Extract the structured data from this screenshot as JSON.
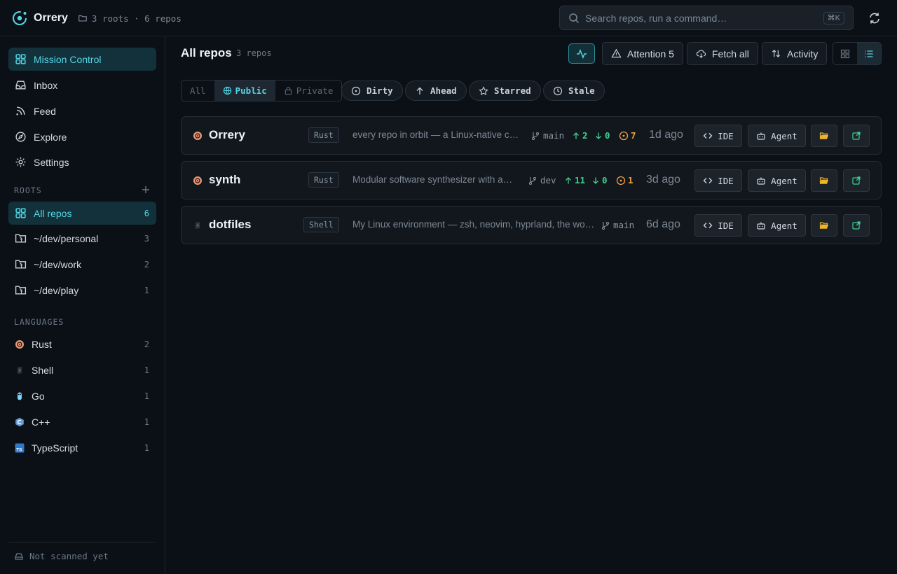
{
  "app": {
    "name": "Orrery",
    "meta": "3 roots · 6 repos",
    "accent": "#55d6e6"
  },
  "search": {
    "placeholder": "Search repos, run a command…",
    "shortcut": "⌘K"
  },
  "sidebar": {
    "nav": [
      {
        "label": "Mission Control",
        "icon": "grid-icon",
        "active": true
      },
      {
        "label": "Inbox",
        "icon": "inbox-icon"
      },
      {
        "label": "Feed",
        "icon": "rss-icon"
      },
      {
        "label": "Explore",
        "icon": "compass-icon"
      },
      {
        "label": "Settings",
        "icon": "gear-icon"
      }
    ],
    "roots_label": "ROOTS",
    "roots": [
      {
        "label": "All repos",
        "count": "6",
        "active": true
      },
      {
        "label": "~/dev/personal",
        "count": "3"
      },
      {
        "label": "~/dev/work",
        "count": "2"
      },
      {
        "label": "~/dev/play",
        "count": "1"
      }
    ],
    "languages_label": "LANGUAGES",
    "languages": [
      {
        "label": "Rust",
        "count": "2",
        "icon": "rust-icon",
        "color": "#e89a7a"
      },
      {
        "label": "Shell",
        "count": "1",
        "icon": "shell-icon",
        "color": "#5a6470"
      },
      {
        "label": "Go",
        "count": "1",
        "icon": "go-icon",
        "color": "#79d4fd"
      },
      {
        "label": "C++",
        "count": "1",
        "icon": "cpp-icon",
        "color": "#659ad2"
      },
      {
        "label": "TypeScript",
        "count": "1",
        "icon": "typescript-icon",
        "color": "#3178c6"
      }
    ],
    "footer": "Not scanned yet"
  },
  "main": {
    "title": "All repos",
    "count": "3 repos",
    "attention_label": "Attention 5",
    "fetch_label": "Fetch all",
    "sort_label": "Activity"
  },
  "filters": {
    "visibility": [
      {
        "label": "All"
      },
      {
        "label": "Public",
        "selected": true
      },
      {
        "label": "Private"
      }
    ],
    "chips": [
      "Dirty",
      "Ahead",
      "Starred",
      "Stale"
    ]
  },
  "repos": [
    {
      "name": "Orrery",
      "lang": "Rust",
      "lang_icon": "rust-icon",
      "description": "every repo in orbit — a Linux-native c…",
      "branch": "main",
      "ahead": "2",
      "behind": "0",
      "issues": "7",
      "updated": "1d ago",
      "ide_label": "IDE",
      "agent_label": "Agent"
    },
    {
      "name": "synth",
      "lang": "Rust",
      "lang_icon": "rust-icon",
      "description": "Modular software synthesizer with a…",
      "branch": "dev",
      "ahead": "11",
      "behind": "0",
      "issues": "1",
      "updated": "3d ago",
      "ide_label": "IDE",
      "agent_label": "Agent"
    },
    {
      "name": "dotfiles",
      "lang": "Shell",
      "lang_icon": "shell-icon",
      "description": "My Linux environment — zsh, neovim, hyprland, the wo…",
      "branch": "main",
      "updated": "6d ago",
      "ide_label": "IDE",
      "agent_label": "Agent"
    }
  ]
}
